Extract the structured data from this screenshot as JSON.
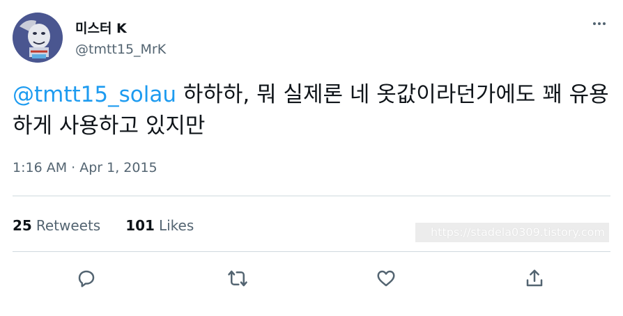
{
  "author": {
    "display_name": "미스터 K",
    "handle": "@tmtt15_MrK"
  },
  "tweet": {
    "mention": "@tmtt15_solau",
    "text": " 하하하, 뭐 실제론 네 옷값이라던가에도 꽤 유용하게 사용하고 있지만",
    "timestamp": "1:16 AM · Apr 1, 2015"
  },
  "stats": {
    "retweets_count": "25",
    "retweets_label": "Retweets",
    "likes_count": "101",
    "likes_label": "Likes"
  },
  "watermark": "https://stadela0309.tistory.com",
  "icons": {
    "more": "more-icon",
    "reply": "reply-icon",
    "retweet": "retweet-icon",
    "like": "heart-icon",
    "share": "share-icon"
  },
  "colors": {
    "accent": "#1d9bf0",
    "secondary_text": "#536471",
    "primary_text": "#0f1419",
    "divider": "#cfd9de"
  }
}
